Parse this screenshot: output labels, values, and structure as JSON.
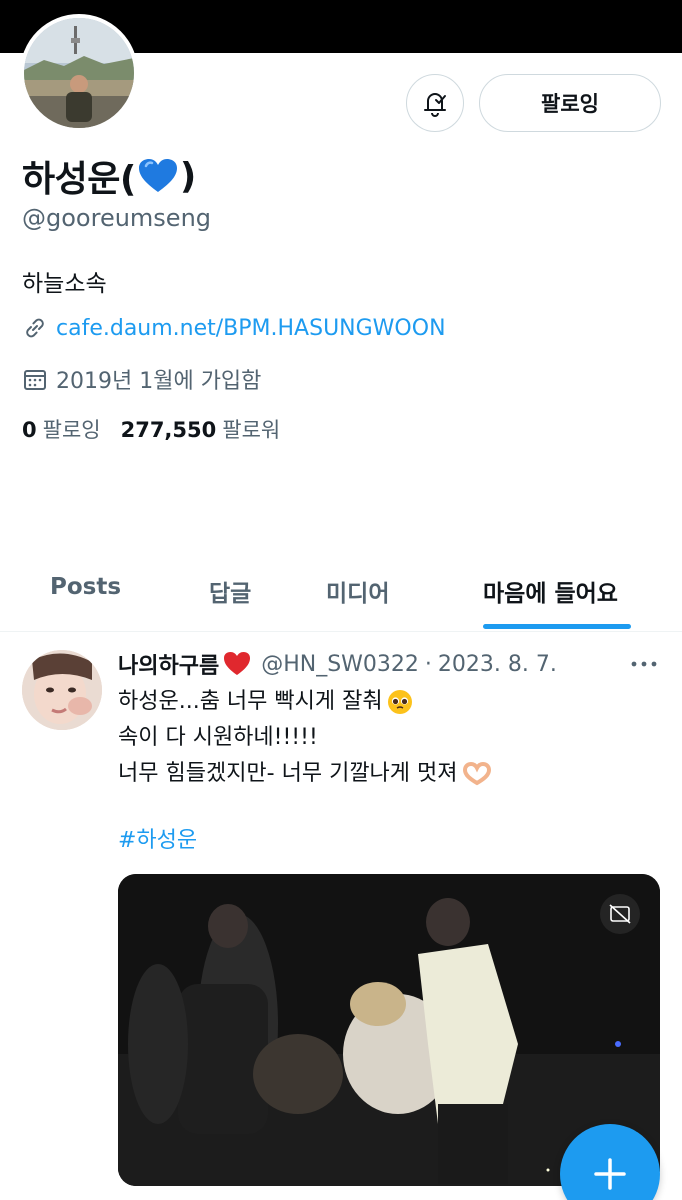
{
  "profile": {
    "display_name": "하성운(",
    "display_name_suffix": ")",
    "name_emoji": "blue-heart",
    "handle": "@gooreumseng",
    "bio": "하늘소속",
    "link": "cafe.daum.net/BPM.HASUNGWOON",
    "joined": "2019년 1월에 가입함",
    "following_count": "0",
    "following_label": "팔로잉",
    "followers_count": "277,550",
    "followers_label": "팔로워"
  },
  "actions": {
    "notify_icon": "bell-check-icon",
    "follow_label": "팔로잉"
  },
  "tabs": [
    {
      "label": "Posts",
      "active": false
    },
    {
      "label": "답글",
      "active": false
    },
    {
      "label": "미디어",
      "active": false
    },
    {
      "label": "마음에 들어요",
      "active": true
    }
  ],
  "tweet": {
    "author": "나의하구름",
    "author_emoji": "red-heart",
    "handle": "@HN_SW0322",
    "separator": "·",
    "date": "2023. 8. 7.",
    "lines": [
      "하성운...춤 너무 빡시게 잘춰",
      "속이 다 시원하네!!!!!",
      "너무 힘들겠지만- 너무 기깔나게 멋져"
    ],
    "line_emojis": [
      "pleading-face",
      "",
      "heart-hands"
    ],
    "hashtag": "#하성운",
    "media_badge_icon": "gif-no-sound-icon"
  },
  "fab": {
    "icon": "plus-icon"
  },
  "colors": {
    "accent": "#1d9bf0",
    "text_primary": "#0f1419",
    "text_secondary": "#536471",
    "border": "#cfd9de"
  }
}
